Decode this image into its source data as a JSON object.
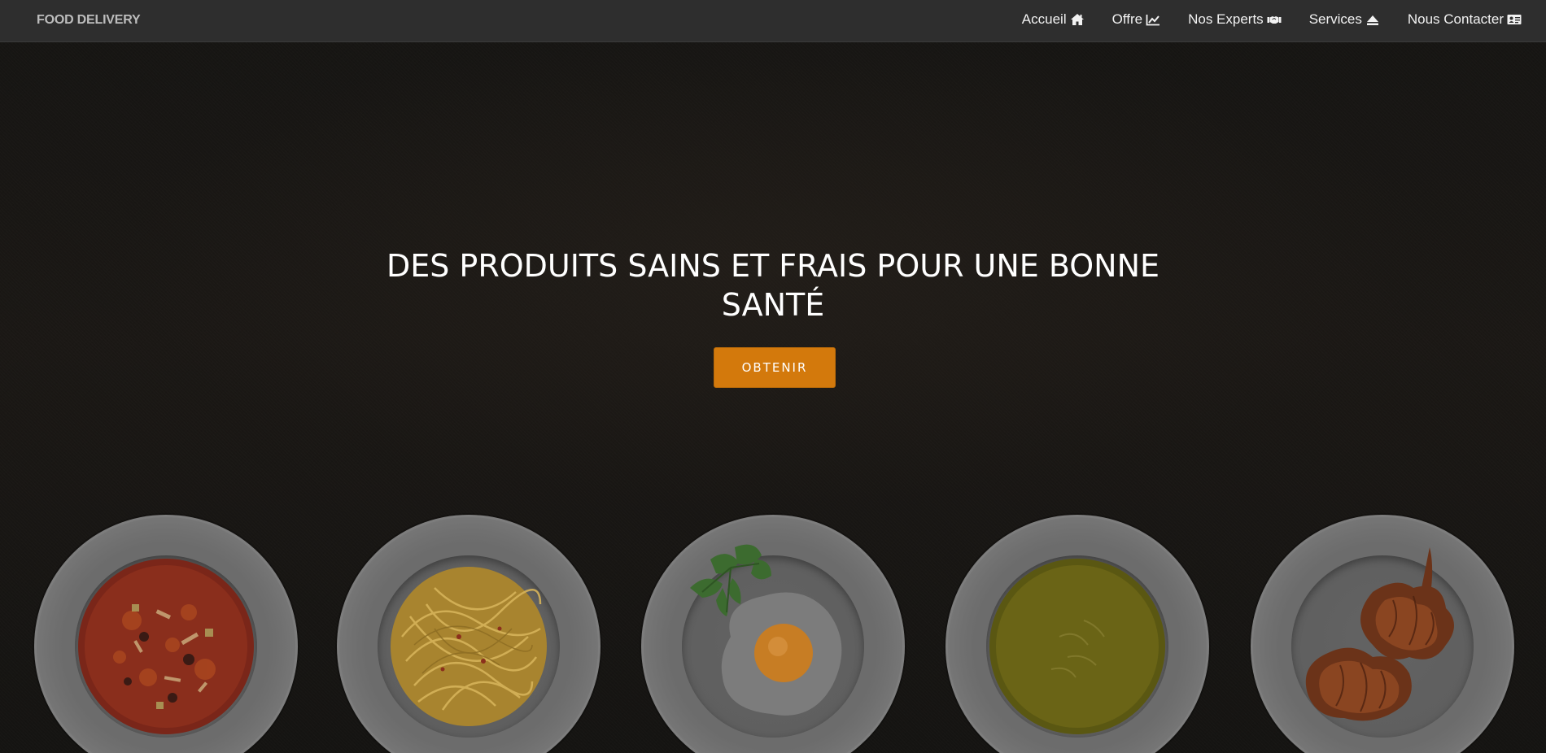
{
  "navbar": {
    "brand": "FOOD DELIVERY",
    "items": [
      {
        "label": "Accueil",
        "icon": "home-icon"
      },
      {
        "label": "Offre",
        "icon": "chart-line-icon"
      },
      {
        "label": "Nos Experts",
        "icon": "handshake-icon"
      },
      {
        "label": "Services",
        "icon": "eject-icon"
      },
      {
        "label": "Nous Contacter",
        "icon": "address-card-icon"
      }
    ]
  },
  "hero": {
    "title_line1": "DES PRODUITS SAINS ET FRAIS POUR UNE BONNE",
    "title_line2": "SANTÉ",
    "cta_label": "OBTENIR"
  },
  "plates": [
    {
      "dish": "minestrone-soup"
    },
    {
      "dish": "spaghetti"
    },
    {
      "dish": "fried-egg-with-parsley"
    },
    {
      "dish": "green-cream-soup"
    },
    {
      "dish": "croissants"
    }
  ],
  "colors": {
    "navbar_bg": "#2e2e2e",
    "accent": "#d3790c",
    "background": "#161513"
  }
}
